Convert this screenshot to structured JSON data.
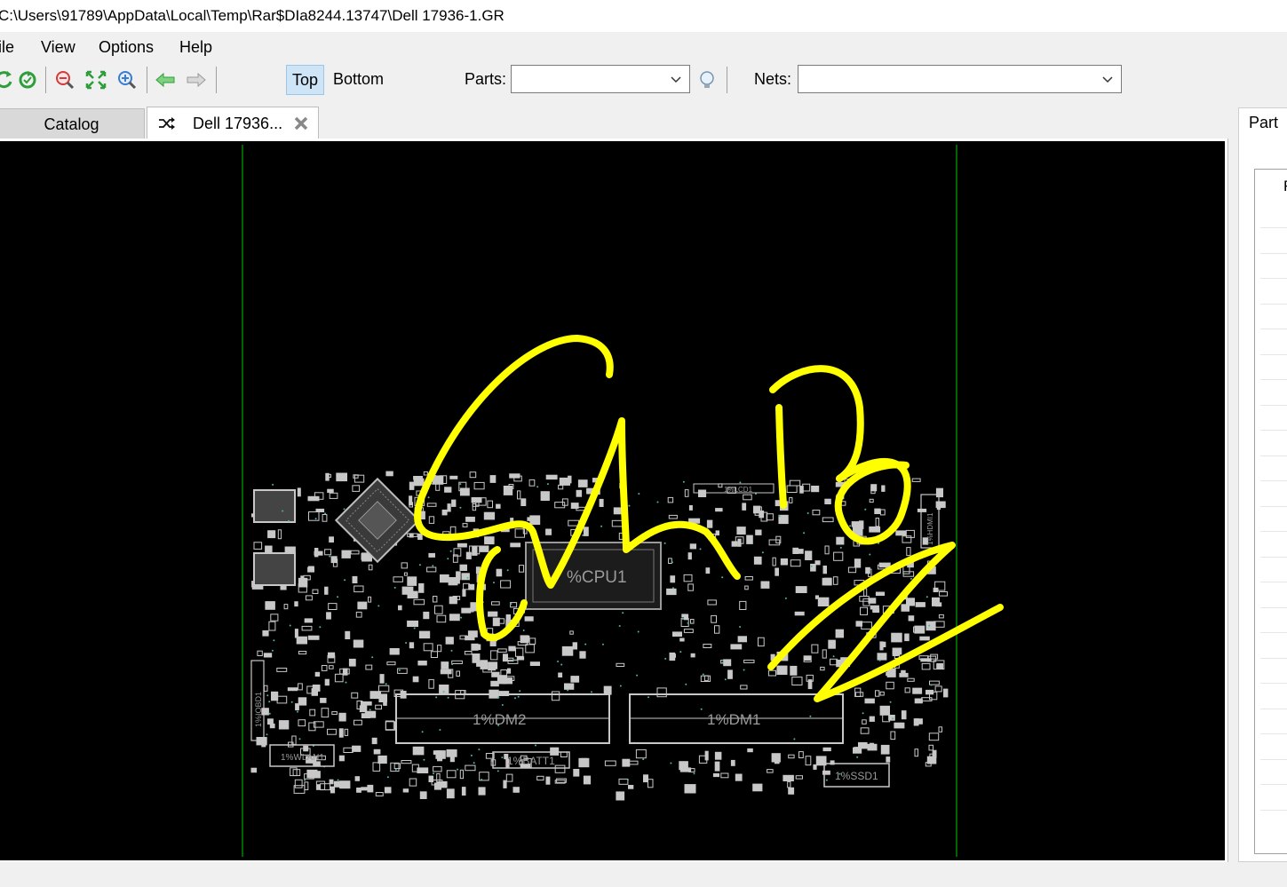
{
  "window": {
    "title": "C:\\Users\\91789\\AppData\\Local\\Temp\\Rar$DIa8244.13747\\Dell 17936-1.GR"
  },
  "menu": {
    "items": [
      "ile",
      "View",
      "Options",
      "Help"
    ]
  },
  "toolbar": {
    "icons": [
      "refresh-icon",
      "rotate-icon",
      "zoom-out-icon",
      "fit-icon",
      "zoom-in-icon",
      "back-arrow-icon",
      "forward-arrow-icon",
      "lightbulb-icon"
    ],
    "side_top": "Top",
    "side_bottom": "Bottom",
    "side_selected": "Top",
    "parts_label": "Parts:",
    "parts_value": "",
    "nets_label": "Nets:",
    "nets_value": ""
  },
  "tabs": [
    {
      "label": "Catalog",
      "active": false
    },
    {
      "label": "Dell 17936...",
      "active": true,
      "icon": "shuffle-icon",
      "close_icon": "close-icon"
    }
  ],
  "board": {
    "background": "#000000",
    "outline_color": "#006400",
    "component_color": "#c8c8c8",
    "annotation_color": "#ffff00",
    "component_labels": [
      "%CPU1",
      "1%DM2",
      "1%DM1",
      "1%WLAN1",
      "1%BATT1",
      "1%SSD1",
      "1%LCD1",
      "1%IOBD1",
      "1%HDMI1"
    ]
  },
  "right_panel": {
    "tab_label": "Part",
    "column_header": "F"
  }
}
